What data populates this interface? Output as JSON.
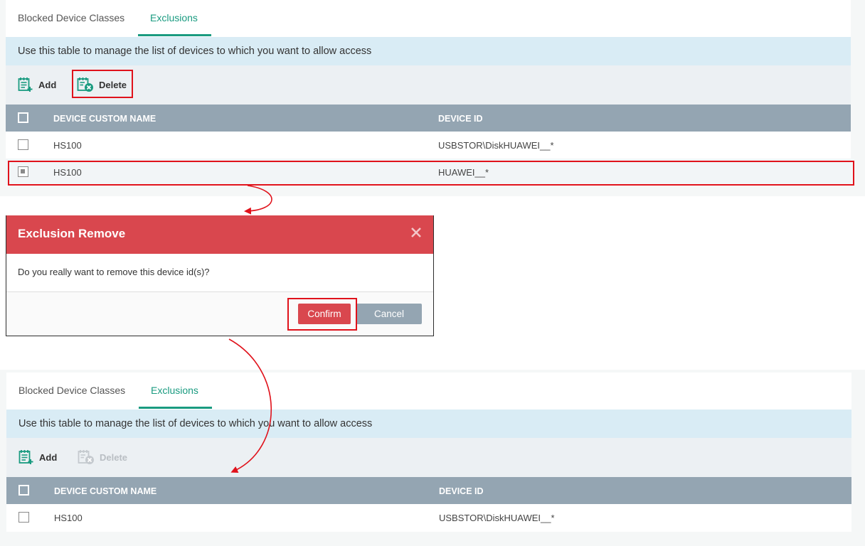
{
  "tabs": {
    "blocked": "Blocked Device Classes",
    "exclusions": "Exclusions"
  },
  "info_text": "Use this table to manage the list of devices to which you want to allow access",
  "toolbar": {
    "add": "Add",
    "delete": "Delete"
  },
  "table": {
    "headers": [
      "DEVICE CUSTOM NAME",
      "DEVICE ID"
    ],
    "rows_before": [
      {
        "name": "HS100",
        "device_id": "USBSTOR\\DiskHUAWEI__*",
        "checked": false
      },
      {
        "name": "HS100",
        "device_id": "HUAWEI__*",
        "checked": true
      }
    ],
    "rows_after": [
      {
        "name": "HS100",
        "device_id": "USBSTOR\\DiskHUAWEI__*",
        "checked": false
      }
    ]
  },
  "modal": {
    "title": "Exclusion Remove",
    "message": "Do you really want to remove this device id(s)?",
    "confirm": "Confirm",
    "cancel": "Cancel"
  },
  "colors": {
    "accent": "#1a9b80",
    "danger": "#d9474e",
    "highlight": "#e0121b",
    "table_header": "#94a5b2"
  }
}
